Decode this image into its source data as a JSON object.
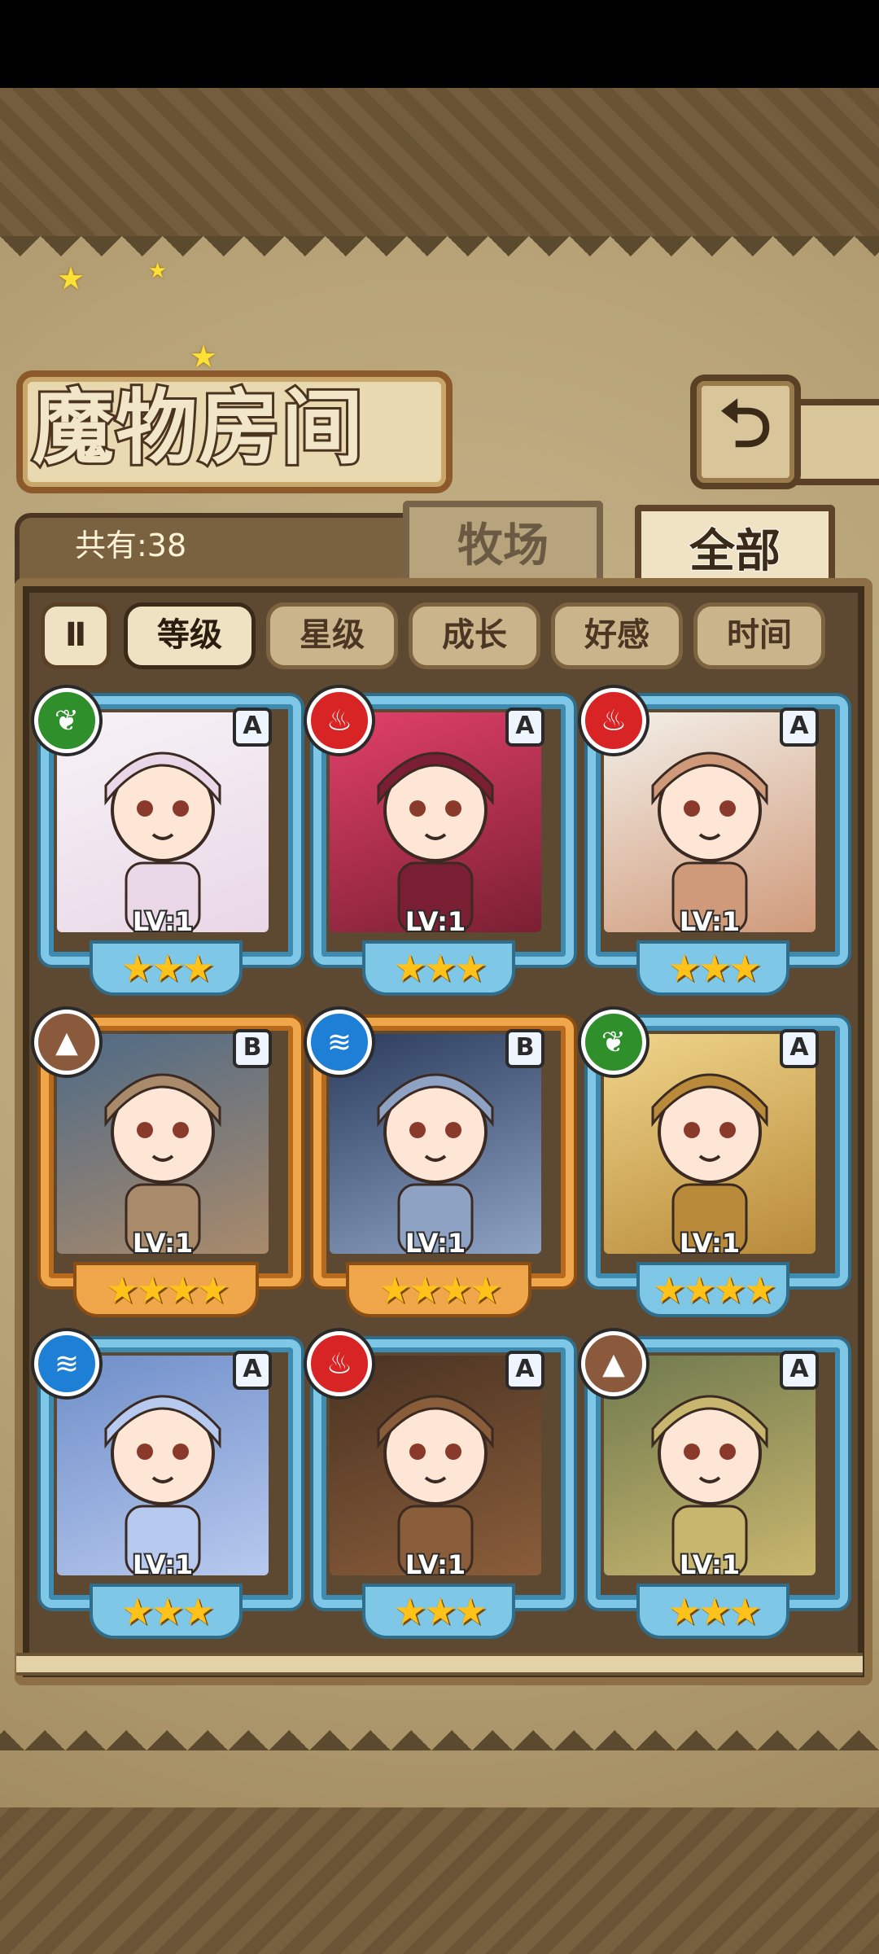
{
  "screen": {
    "title": "魔物房间",
    "count_label": "共有:38",
    "back_icon": "⮌"
  },
  "tabs": [
    {
      "label": "牧场",
      "active": false
    },
    {
      "label": "全部",
      "active": true
    }
  ],
  "sort": {
    "toggle_label": "Ⅱ",
    "buttons": [
      {
        "label": "等级",
        "active": true
      },
      {
        "label": "星级",
        "active": false
      },
      {
        "label": "成长",
        "active": false
      },
      {
        "label": "好感",
        "active": false
      },
      {
        "label": "时间",
        "active": false
      }
    ]
  },
  "monsters": [
    {
      "element": "leaf",
      "rank": "A",
      "level": "LV:1",
      "stars": "★★★"
    },
    {
      "element": "fire",
      "rank": "A",
      "level": "LV:1",
      "stars": "★★★"
    },
    {
      "element": "fire",
      "rank": "A",
      "level": "LV:1",
      "stars": "★★★"
    },
    {
      "element": "earth",
      "rank": "B",
      "level": "LV:1",
      "stars": "★★★★"
    },
    {
      "element": "water",
      "rank": "B",
      "level": "LV:1",
      "stars": "★★★★"
    },
    {
      "element": "leaf",
      "rank": "A",
      "level": "LV:1",
      "stars": "★★★★"
    },
    {
      "element": "water",
      "rank": "A",
      "level": "LV:1",
      "stars": "★★★"
    },
    {
      "element": "fire",
      "rank": "A",
      "level": "LV:1",
      "stars": "★★★"
    },
    {
      "element": "earth",
      "rank": "A",
      "level": "LV:1",
      "stars": "★★★"
    }
  ],
  "colors": {
    "frame_a": "#7fc7e6",
    "frame_b": "#f0a64b",
    "star": "#ffc21a",
    "leaf": "#2f8f2a",
    "fire": "#d82424",
    "earth": "#8b5a3c",
    "water": "#1e7fd6"
  }
}
